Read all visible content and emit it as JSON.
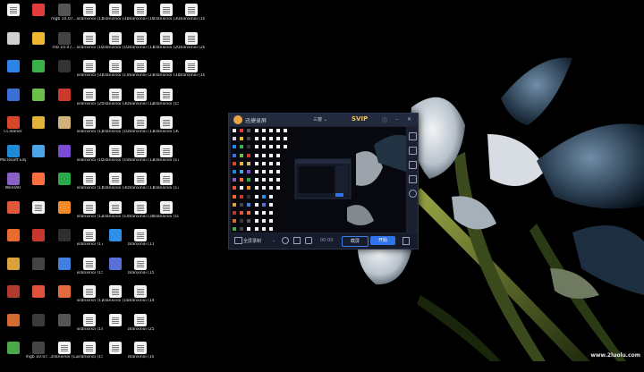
{
  "desktop": {
    "icons": [
      {
        "label": "",
        "color": "#eeeeee",
        "shape": "doc"
      },
      {
        "label": "",
        "color": "#e23c3c",
        "shape": "app"
      },
      {
        "label": "mgb 10.07...",
        "color": "#555555",
        "shape": "app"
      },
      {
        "label": "xilanxinoi (1)",
        "color": "#f3f3f3",
        "shape": "doc"
      },
      {
        "label": "zilanxinoi (31)",
        "color": "#f3f3f3",
        "shape": "doc"
      },
      {
        "label": "zilanxinoi (10)",
        "color": "#f3f3f3",
        "shape": "doc"
      },
      {
        "label": "zilanxinoi (30)",
        "color": "#f3f3f3",
        "shape": "doc"
      },
      {
        "label": "zilanxinoi (10)",
        "color": "#f3f3f3",
        "shape": "doc"
      },
      {
        "label": "",
        "color": "#cfcfcf",
        "shape": "app"
      },
      {
        "label": "",
        "color": "#f0b730",
        "shape": "app"
      },
      {
        "label": "rnb 10.07...",
        "color": "#444444",
        "shape": "app"
      },
      {
        "label": "xilanxinoi (10)",
        "color": "#f3f3f3",
        "shape": "doc"
      },
      {
        "label": "zilanxinoi (10)",
        "color": "#f3f3f3",
        "shape": "doc"
      },
      {
        "label": "zilanxinoi (11)",
        "color": "#f3f3f3",
        "shape": "doc"
      },
      {
        "label": "zilanxinoi (20)",
        "color": "#f3f3f3",
        "shape": "doc"
      },
      {
        "label": "zilanxinoi (20)",
        "color": "#f3f3f3",
        "shape": "doc"
      },
      {
        "label": "",
        "color": "#2b84e6",
        "shape": "app"
      },
      {
        "label": "",
        "color": "#38b14a",
        "shape": "app"
      },
      {
        "label": "",
        "color": "#333333",
        "shape": "app"
      },
      {
        "label": "xilanxinoi (3)",
        "color": "#f3f3f3",
        "shape": "doc"
      },
      {
        "label": "zilanxinoi (1)",
        "color": "#f3f3f3",
        "shape": "doc"
      },
      {
        "label": "zilanxinoi (23)",
        "color": "#f3f3f3",
        "shape": "doc"
      },
      {
        "label": "zilanxinoi (31)",
        "color": "#f3f3f3",
        "shape": "doc"
      },
      {
        "label": "zilanxinoi (10)",
        "color": "#f3f3f3",
        "shape": "doc"
      },
      {
        "label": "",
        "color": "#3a6fd6",
        "shape": "app"
      },
      {
        "label": "",
        "color": "#6cc04a",
        "shape": "app"
      },
      {
        "label": "",
        "color": "#c9392c",
        "shape": "app"
      },
      {
        "label": "xilanxinoi (25)",
        "color": "#f3f3f3",
        "shape": "doc"
      },
      {
        "label": "zilanxinoi (30)",
        "color": "#f3f3f3",
        "shape": "doc"
      },
      {
        "label": "zilanxinoi (12)",
        "color": "#f3f3f3",
        "shape": "doc"
      },
      {
        "label": "zilanxinoi (15)",
        "color": "#f3f3f3",
        "shape": "doc"
      },
      {
        "label": "",
        "color": "#000000",
        "shape": "none"
      },
      {
        "label": "CCleaner",
        "color": "#d9472b",
        "shape": "app"
      },
      {
        "label": "",
        "color": "#e2b23a",
        "shape": "app"
      },
      {
        "label": "",
        "color": "#d0b27a",
        "shape": "app"
      },
      {
        "label": "xilanxinoi (1)",
        "color": "#f3f3f3",
        "shape": "doc"
      },
      {
        "label": "zilanxinoi (10)",
        "color": "#f3f3f3",
        "shape": "doc"
      },
      {
        "label": "zilanxinoi (17)",
        "color": "#f3f3f3",
        "shape": "doc"
      },
      {
        "label": "zilanxinoi (30)",
        "color": "#f3f3f3",
        "shape": "doc"
      },
      {
        "label": "",
        "color": "#000000",
        "shape": "none"
      },
      {
        "label": "Microsoft Edge",
        "color": "#1f8ad8",
        "shape": "app"
      },
      {
        "label": "",
        "color": "#4aa4e6",
        "shape": "app"
      },
      {
        "label": "",
        "color": "#7a4bd3",
        "shape": "app"
      },
      {
        "label": "xilanxinoi (10)",
        "color": "#f3f3f3",
        "shape": "doc"
      },
      {
        "label": "zilanxinoi (19)",
        "color": "#f3f3f3",
        "shape": "doc"
      },
      {
        "label": "zilanxinoi (13)",
        "color": "#f3f3f3",
        "shape": "doc"
      },
      {
        "label": "zilanxinoi (17)",
        "color": "#f3f3f3",
        "shape": "doc"
      },
      {
        "label": "",
        "color": "#000000",
        "shape": "none"
      },
      {
        "label": "WinRAR",
        "color": "#8a5fc7",
        "shape": "app"
      },
      {
        "label": "",
        "color": "#ff6f3d",
        "shape": "app"
      },
      {
        "label": "",
        "color": "#2aa84a",
        "shape": "app"
      },
      {
        "label": "xilanxinoi (11)",
        "color": "#f3f3f3",
        "shape": "doc"
      },
      {
        "label": "zilanxinoi (30)",
        "color": "#f3f3f3",
        "shape": "doc"
      },
      {
        "label": "zilanxinoi (11)",
        "color": "#f3f3f3",
        "shape": "doc"
      },
      {
        "label": "zilanxinoi (17)",
        "color": "#f3f3f3",
        "shape": "doc"
      },
      {
        "label": "",
        "color": "#000000",
        "shape": "none"
      },
      {
        "label": "",
        "color": "#e0573a",
        "shape": "app"
      },
      {
        "label": "",
        "color": "#f3f3f3",
        "shape": "doc"
      },
      {
        "label": "",
        "color": "#f58a2d",
        "shape": "app"
      },
      {
        "label": "xilanxinoi (12)",
        "color": "#f3f3f3",
        "shape": "doc"
      },
      {
        "label": "zilanxinoi (14)",
        "color": "#f3f3f3",
        "shape": "doc"
      },
      {
        "label": "zilanxinoi (30)",
        "color": "#f3f3f3",
        "shape": "doc"
      },
      {
        "label": "zilanxinoi (10)",
        "color": "#f3f3f3",
        "shape": "doc"
      },
      {
        "label": "",
        "color": "#000000",
        "shape": "none"
      },
      {
        "label": "",
        "color": "#e86a2c",
        "shape": "app"
      },
      {
        "label": "",
        "color": "#c8372d",
        "shape": "app"
      },
      {
        "label": "",
        "color": "#2f2f2f",
        "shape": "app"
      },
      {
        "label": "xilanxinoi (17)",
        "color": "#f3f3f3",
        "shape": "doc"
      },
      {
        "label": "",
        "color": "#2e8fe6",
        "shape": "app"
      },
      {
        "label": "zilanxinoi (11)",
        "color": "#f3f3f3",
        "shape": "doc"
      },
      {
        "label": "",
        "color": "#000000",
        "shape": "none"
      },
      {
        "label": "",
        "color": "#000000",
        "shape": "none"
      },
      {
        "label": "",
        "color": "#d9a23b",
        "shape": "app"
      },
      {
        "label": "",
        "color": "#444444",
        "shape": "app"
      },
      {
        "label": "",
        "color": "#3f7fe0",
        "shape": "app"
      },
      {
        "label": "xilanxinoi (15)",
        "color": "#f3f3f3",
        "shape": "doc"
      },
      {
        "label": "",
        "color": "#5a6fd8",
        "shape": "app"
      },
      {
        "label": "zilanxinoi (15)",
        "color": "#f3f3f3",
        "shape": "doc"
      },
      {
        "label": "",
        "color": "#000000",
        "shape": "none"
      },
      {
        "label": "",
        "color": "#000000",
        "shape": "none"
      },
      {
        "label": "",
        "color": "#b33a2f",
        "shape": "app"
      },
      {
        "label": "",
        "color": "#e0533a",
        "shape": "app"
      },
      {
        "label": "",
        "color": "#e46b3d",
        "shape": "app"
      },
      {
        "label": "xilanxinoi (17)",
        "color": "#f3f3f3",
        "shape": "doc"
      },
      {
        "label": "zilanxinoi (18)",
        "color": "#f3f3f3",
        "shape": "doc"
      },
      {
        "label": "zilanxinoi (14)",
        "color": "#f3f3f3",
        "shape": "doc"
      },
      {
        "label": "",
        "color": "#000000",
        "shape": "none"
      },
      {
        "label": "",
        "color": "#000000",
        "shape": "none"
      },
      {
        "label": "",
        "color": "#d46a2f",
        "shape": "app"
      },
      {
        "label": "",
        "color": "#3a3a3a",
        "shape": "app"
      },
      {
        "label": "",
        "color": "#555555",
        "shape": "app"
      },
      {
        "label": "xilanxinoi (14)",
        "color": "#f3f3f3",
        "shape": "doc"
      },
      {
        "label": "",
        "color": "#f3f3f3",
        "shape": "doc"
      },
      {
        "label": "zilanxinoi (25)",
        "color": "#f3f3f3",
        "shape": "doc"
      },
      {
        "label": "",
        "color": "#000000",
        "shape": "none"
      },
      {
        "label": "",
        "color": "#000000",
        "shape": "none"
      },
      {
        "label": "",
        "color": "#4aa84a",
        "shape": "app"
      },
      {
        "label": "mgb 10.07...",
        "color": "#444444",
        "shape": "app"
      },
      {
        "label": "zilanxinoi (12)",
        "color": "#f3f3f3",
        "shape": "doc"
      },
      {
        "label": "xilanxinoi (15)",
        "color": "#f3f3f3",
        "shape": "doc"
      },
      {
        "label": "",
        "color": "#f3f3f3",
        "shape": "doc"
      },
      {
        "label": "zilanxinoi (10)",
        "color": "#f3f3f3",
        "shape": "doc"
      },
      {
        "label": "",
        "color": "#000000",
        "shape": "none"
      },
      {
        "label": "",
        "color": "#000000",
        "shape": "none"
      }
    ]
  },
  "recorder": {
    "title": "迅捷录屏",
    "mode": "三窗 ⌄",
    "vip": "SVIP",
    "help_icon": "ⓘ",
    "minimize_icon": "–",
    "close_icon": "✕",
    "area_label": "全屏录制",
    "timer": "00:00",
    "screenshot_label": "截屏",
    "start_label": "开始",
    "accent": "#2f74ea",
    "vip_color": "#f2c14e"
  },
  "watermark": "www.2luolu.com"
}
